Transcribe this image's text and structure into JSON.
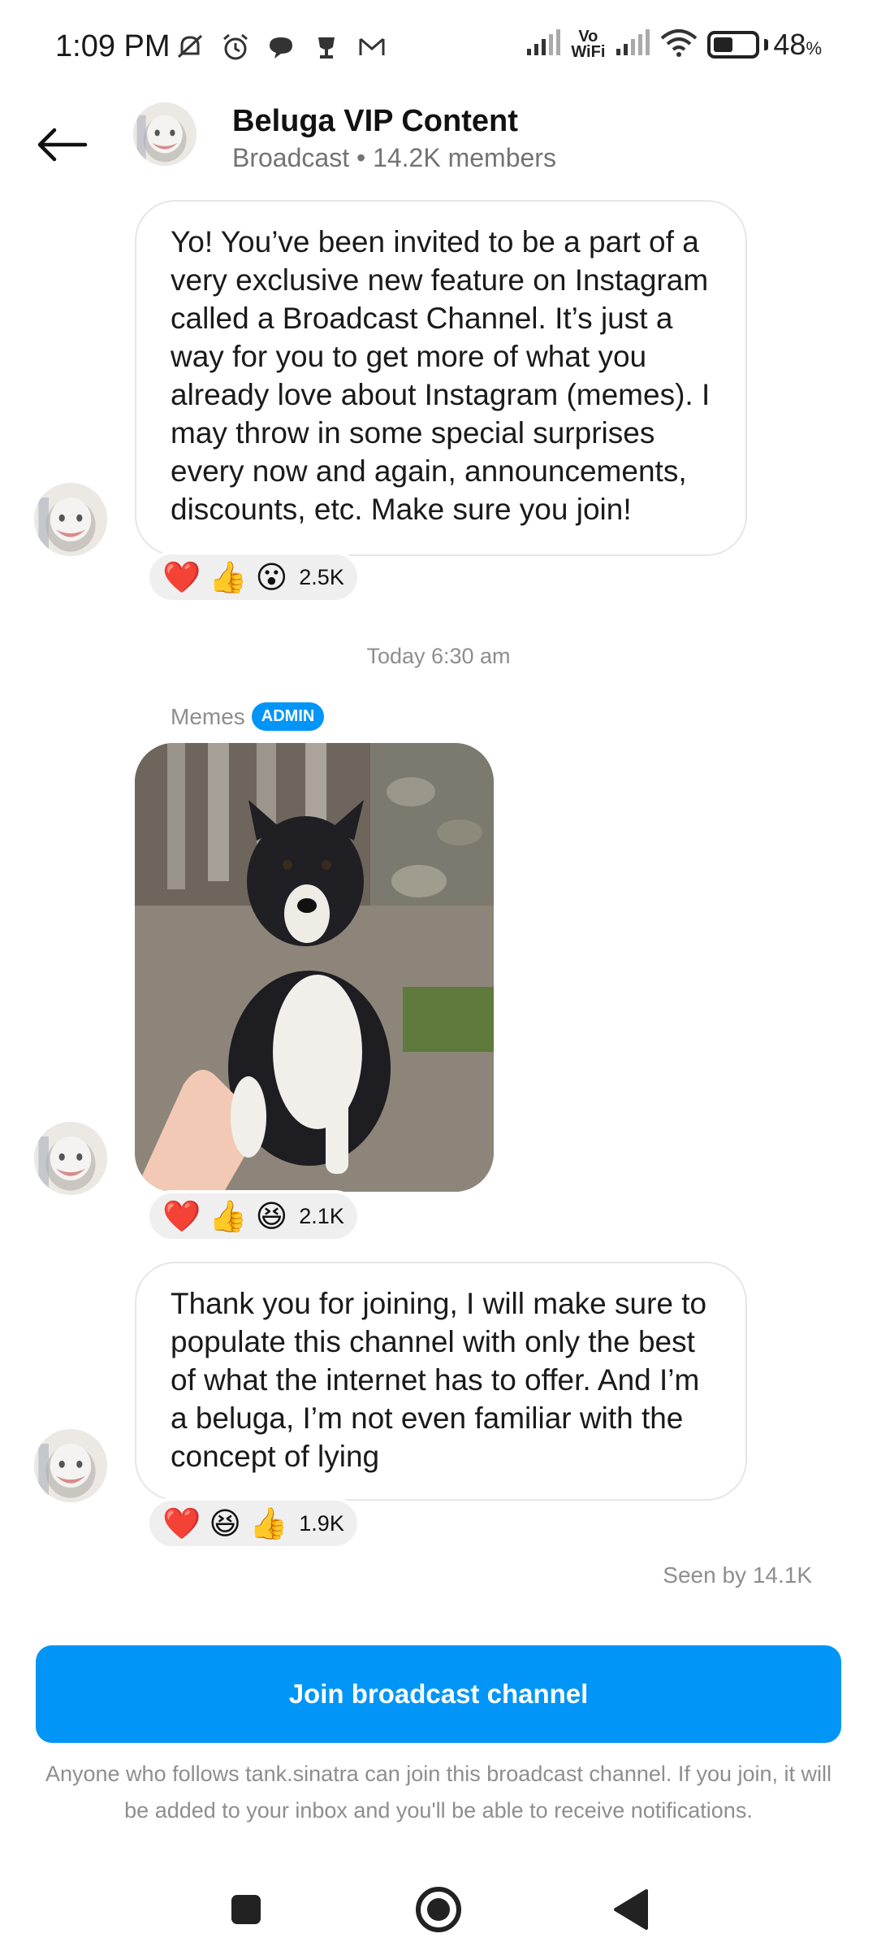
{
  "status_bar": {
    "time": "1:09 PM",
    "vo_label": "Vo",
    "wifi_label": "WiFi",
    "battery_percent": "48",
    "battery_unit": "%",
    "battery_level": 0.48
  },
  "header": {
    "title": "Beluga VIP Content",
    "subtitle": "Broadcast • 14.2K members"
  },
  "messages": [
    {
      "text": "Yo! You’ve been invited to be a part of a very exclusive new feature on Instagram called a Broadcast Channel. It’s just a way for you to get more of what you already love about Instagram (memes). I may throw in some special surprises every now and again, announcements, discounts, etc. Make sure you join!",
      "reactions": [
        "❤️",
        "👍",
        "😮"
      ],
      "reaction_count": "2.5K"
    },
    {
      "reactions": [
        "❤️",
        "👍",
        "😆"
      ],
      "reaction_count": "2.1K"
    },
    {
      "text": "Thank you for joining, I will make sure to populate this channel with only the best of what the internet has to offer. And I’m a beluga, I’m not even familiar with the concept of lying",
      "reactions": [
        "❤️",
        "😆",
        "👍"
      ],
      "reaction_count": "1.9K"
    }
  ],
  "timestamp": "Today 6:30 am",
  "sender": {
    "name": "Memes",
    "badge": "ADMIN"
  },
  "seen": "Seen by 14.1K",
  "join_button": "Join broadcast channel",
  "join_note": "Anyone who follows tank.sinatra can join this broadcast channel. If you join, it will be added to your inbox and you'll be able to receive notifications.",
  "colors": {
    "accent": "#0095f6",
    "muted_text": "#8e8e8e",
    "reaction_bg": "#efefef"
  },
  "icons": {
    "back": "arrow-left-icon",
    "nav": [
      "recents-square-icon",
      "home-circle-icon",
      "back-triangle-icon"
    ]
  }
}
